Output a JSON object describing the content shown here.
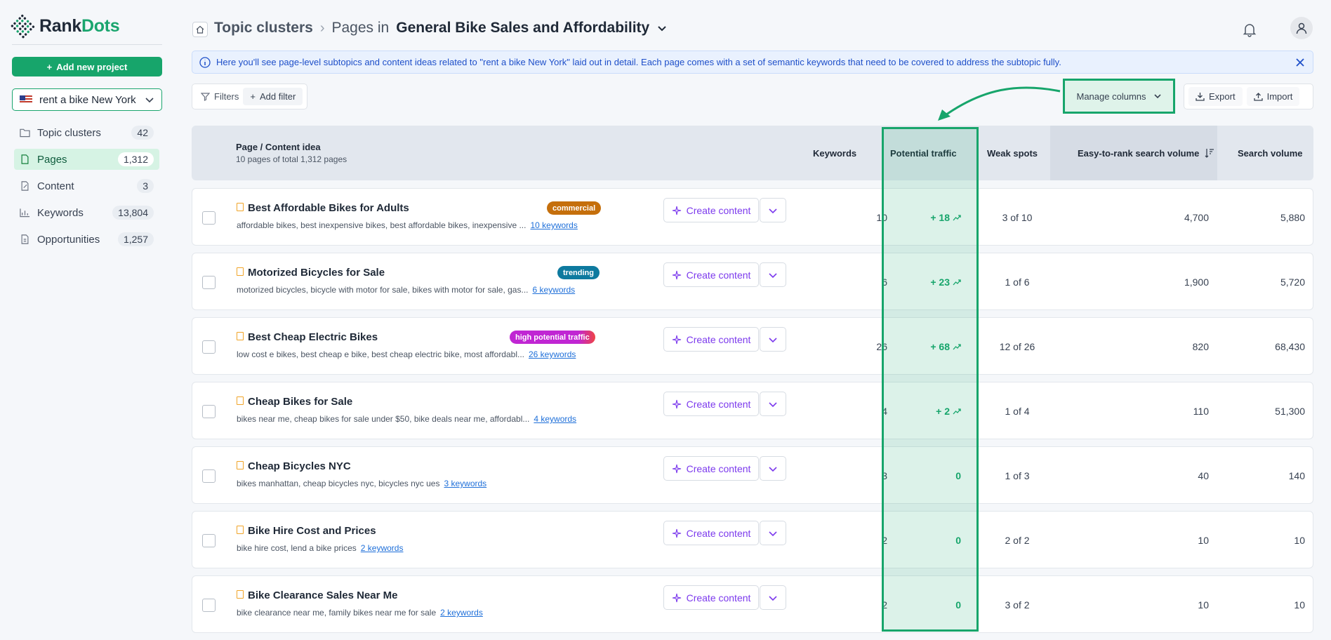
{
  "brand": {
    "name_part1": "Rank",
    "name_part2": "Dots",
    "accent": "#17a56b"
  },
  "sidebar": {
    "add_project_label": "Add new project",
    "project": "rent a bike New York",
    "items": [
      {
        "label": "Topic clusters",
        "count": "42",
        "icon": "folder-icon"
      },
      {
        "label": "Pages",
        "count": "1,312",
        "icon": "page-icon",
        "active": true
      },
      {
        "label": "Content",
        "count": "3",
        "icon": "edit-icon"
      },
      {
        "label": "Keywords",
        "count": "13,804",
        "icon": "chart-icon"
      },
      {
        "label": "Opportunities",
        "count": "1,257",
        "icon": "doc-icon"
      }
    ]
  },
  "header": {
    "crumb_root": "Topic clusters",
    "crumb_pages": "Pages in",
    "crumb_current": "General Bike Sales and Affordability"
  },
  "info_text": "Here you'll see page-level subtopics and content ideas related to \"rent a bike New York\" laid out in detail. Each page comes with a set of semantic keywords that need to be covered to address the subtopic fully.",
  "toolbar": {
    "filters_label": "Filters",
    "add_filter_label": "Add filter",
    "manage_columns_label": "Manage columns",
    "export_label": "Export",
    "import_label": "Import"
  },
  "table": {
    "col_page": "Page / Content idea",
    "col_page_sub": "10 pages of total 1,312 pages",
    "col_keywords": "Keywords",
    "col_potential": "Potential traffic",
    "col_weak": "Weak spots",
    "col_easy": "Easy-to-rank search volume",
    "col_volume": "Search volume",
    "create_label": "Create content",
    "rows": [
      {
        "title": "Best Affordable Bikes for Adults",
        "tag": "commercial",
        "desc": "affordable bikes, best inexpensive bikes, best affordable bikes, inexpensive ...",
        "kw_link": "10 keywords",
        "keywords": "10",
        "potential": "+ 18",
        "trend": true,
        "weak": "3 of 10",
        "easy": "4,700",
        "volume": "5,880"
      },
      {
        "title": "Motorized Bicycles for Sale",
        "tag": "trending",
        "desc": "motorized bicycles, bicycle with motor for sale, bikes with motor for sale, gas...",
        "kw_link": "6 keywords",
        "keywords": "6",
        "potential": "+ 23",
        "trend": true,
        "weak": "1 of 6",
        "easy": "1,900",
        "volume": "5,720"
      },
      {
        "title": "Best Cheap Electric Bikes",
        "tag": "high potential traffic",
        "desc": "low cost e bikes, best cheap e bike, best cheap electric bike, most affordabl...",
        "kw_link": "26 keywords",
        "keywords": "26",
        "potential": "+ 68",
        "trend": true,
        "weak": "12 of 26",
        "easy": "820",
        "volume": "68,430"
      },
      {
        "title": "Cheap Bikes for Sale",
        "tag": "",
        "desc": "bikes near me, cheap bikes for sale under $50, bike deals near me, affordabl...",
        "kw_link": "4 keywords",
        "keywords": "4",
        "potential": "+ 2",
        "trend": true,
        "weak": "1 of 4",
        "easy": "110",
        "volume": "51,300"
      },
      {
        "title": "Cheap Bicycles NYC",
        "tag": "",
        "desc": "bikes manhattan, cheap bicycles nyc, bicycles nyc ues",
        "kw_link": "3 keywords",
        "keywords": "3",
        "potential": "0",
        "trend": false,
        "weak": "1 of 3",
        "easy": "40",
        "volume": "140"
      },
      {
        "title": "Bike Hire Cost and Prices",
        "tag": "",
        "desc": "bike hire cost, lend a bike prices",
        "kw_link": "2 keywords",
        "keywords": "2",
        "potential": "0",
        "trend": false,
        "weak": "2 of 2",
        "easy": "10",
        "volume": "10"
      },
      {
        "title": "Bike Clearance Sales Near Me",
        "tag": "",
        "desc": "bike clearance near me, family bikes near me for sale",
        "kw_link": "2 keywords",
        "keywords": "2",
        "potential": "0",
        "trend": false,
        "weak": "3 of 2",
        "easy": "10",
        "volume": "10"
      }
    ]
  }
}
